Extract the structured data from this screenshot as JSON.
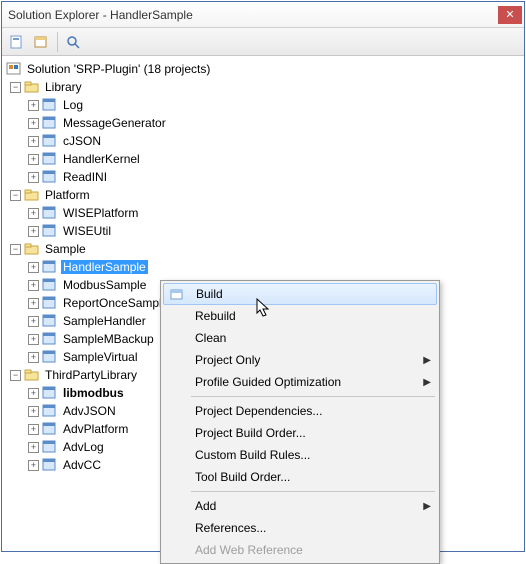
{
  "window": {
    "title": "Solution Explorer - HandlerSample"
  },
  "toolbar": {
    "btn1": "properties-icon",
    "btn2": "show-all-icon",
    "btn3": "view-code-icon"
  },
  "solution": {
    "label": "Solution 'SRP-Plugin' (18 projects)"
  },
  "library": {
    "label": "Library",
    "items": [
      "Log",
      "MessageGenerator",
      "cJSON",
      "HandlerKernel",
      "ReadINI"
    ]
  },
  "platform": {
    "label": "Platform",
    "items": [
      "WISEPlatform",
      "WISEUtil"
    ]
  },
  "sample": {
    "label": "Sample",
    "items": [
      "HandlerSample",
      "ModbusSample",
      "ReportOnceSample",
      "SampleHandler",
      "SampleMBackup",
      "SampleVirtual"
    ]
  },
  "third": {
    "label": "ThirdPartyLibrary",
    "items": [
      "libmodbus",
      "AdvJSON",
      "AdvPlatform",
      "AdvLog",
      "AdvCC"
    ]
  },
  "menu": {
    "build": "Build",
    "rebuild": "Rebuild",
    "clean": "Clean",
    "projectOnly": "Project Only",
    "pgo": "Profile Guided Optimization",
    "deps": "Project Dependencies...",
    "order": "Project Build Order...",
    "custom": "Custom Build Rules...",
    "toolOrder": "Tool Build Order...",
    "add": "Add",
    "refs": "References...",
    "addWeb": "Add Web Reference"
  }
}
